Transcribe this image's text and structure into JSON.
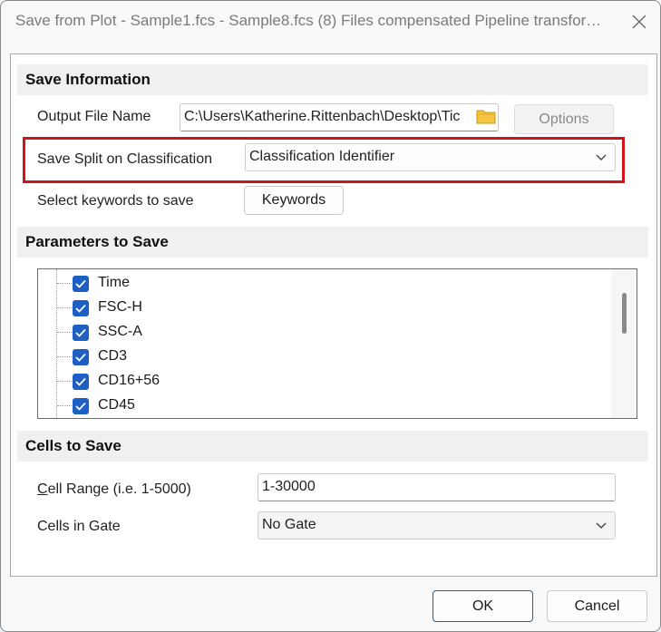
{
  "window": {
    "title": "Save from Plot - Sample1.fcs - Sample8.fcs (8) Files compensated Pipeline transfor…"
  },
  "save_information": {
    "header": "Save Information",
    "output_file_label": "Output File Name",
    "output_file_value": "C:\\Users\\Katherine.Rittenbach\\Desktop\\Tic",
    "options_label": "Options",
    "save_split_label": "Save Split on Classification",
    "save_split_value": "Classification Identifier",
    "keywords_label": "Select keywords to save",
    "keywords_button": "Keywords"
  },
  "parameters": {
    "header": "Parameters to Save",
    "items": [
      {
        "name": "Time",
        "checked": true
      },
      {
        "name": "FSC-H",
        "checked": true
      },
      {
        "name": "SSC-A",
        "checked": true
      },
      {
        "name": "CD3",
        "checked": true
      },
      {
        "name": "CD16+56",
        "checked": true
      },
      {
        "name": "CD45",
        "checked": true
      }
    ]
  },
  "cells": {
    "header": "Cells to Save",
    "range_label": "Cell Range (i.e. 1-5000)",
    "range_value": "1-30000",
    "gate_label": "Cells in Gate",
    "gate_value": "No Gate"
  },
  "footer": {
    "ok_label": "OK",
    "cancel_label": "Cancel"
  },
  "colors": {
    "highlight": "#d4121c",
    "checkbox": "#1e5fc4",
    "primary_border": "#1e5fa8"
  },
  "icons": [
    "close-icon",
    "folder-icon",
    "chevron-down-icon",
    "checkmark-icon"
  ]
}
